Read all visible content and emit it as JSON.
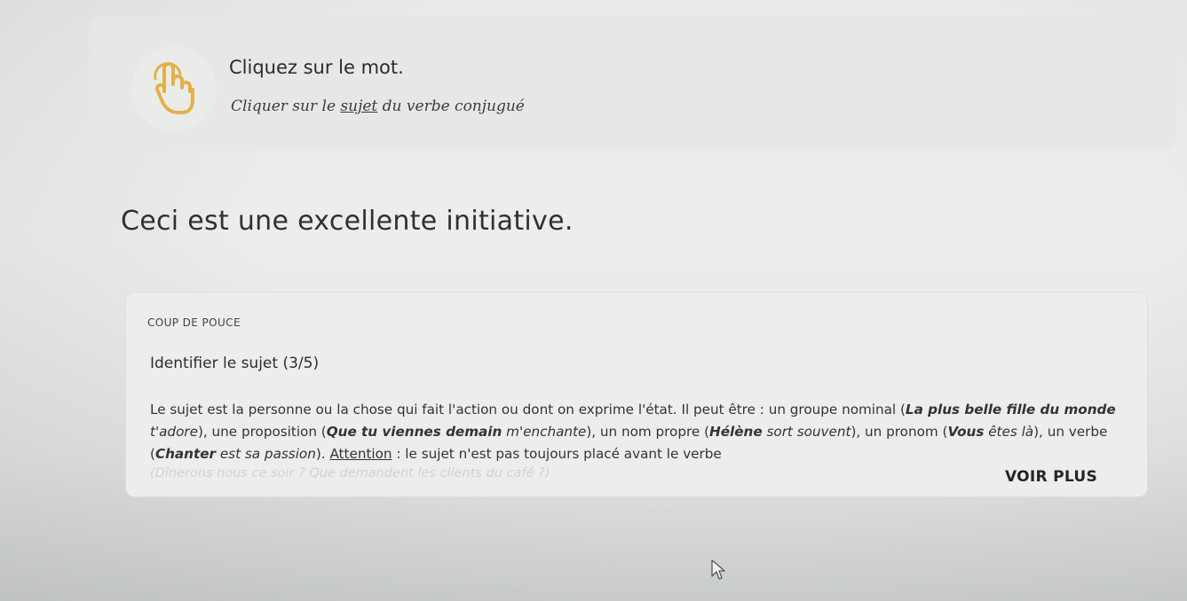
{
  "banner": {
    "title": "Cliquez sur le mot.",
    "sub_before": "Cliquer sur le ",
    "sub_underlined": "sujet",
    "sub_after": " du verbe conjugué",
    "icon": "hand-pointer-icon"
  },
  "sentence": "Ceci est une excellente initiative.",
  "hint": {
    "eyebrow": "COUP DE POUCE",
    "title": "Identifier le sujet (3/5)",
    "text": [
      "Le sujet est la personne ou la chose qui fait l'action ou dont on exprime l'état. Il peut être : un groupe nominal (",
      "La plus belle fille du monde",
      " t'adore",
      "), une proposition (",
      "Que tu viennes demain",
      " m'enchante",
      "), un nom propre (",
      "Hélène",
      " sort souvent",
      "), un pronom (",
      "Vous",
      " êtes là",
      "), un verbe (",
      "Chanter",
      " est sa passion",
      "). ",
      "Attention",
      " : le sujet n'est pas toujours placé avant le verbe"
    ],
    "faded_text": "(Dînerons nous ce soir ? Que demandent les clients du café ?)",
    "see_more": "VOIR PLUS"
  },
  "colors": {
    "accent": "#e6b34a"
  }
}
